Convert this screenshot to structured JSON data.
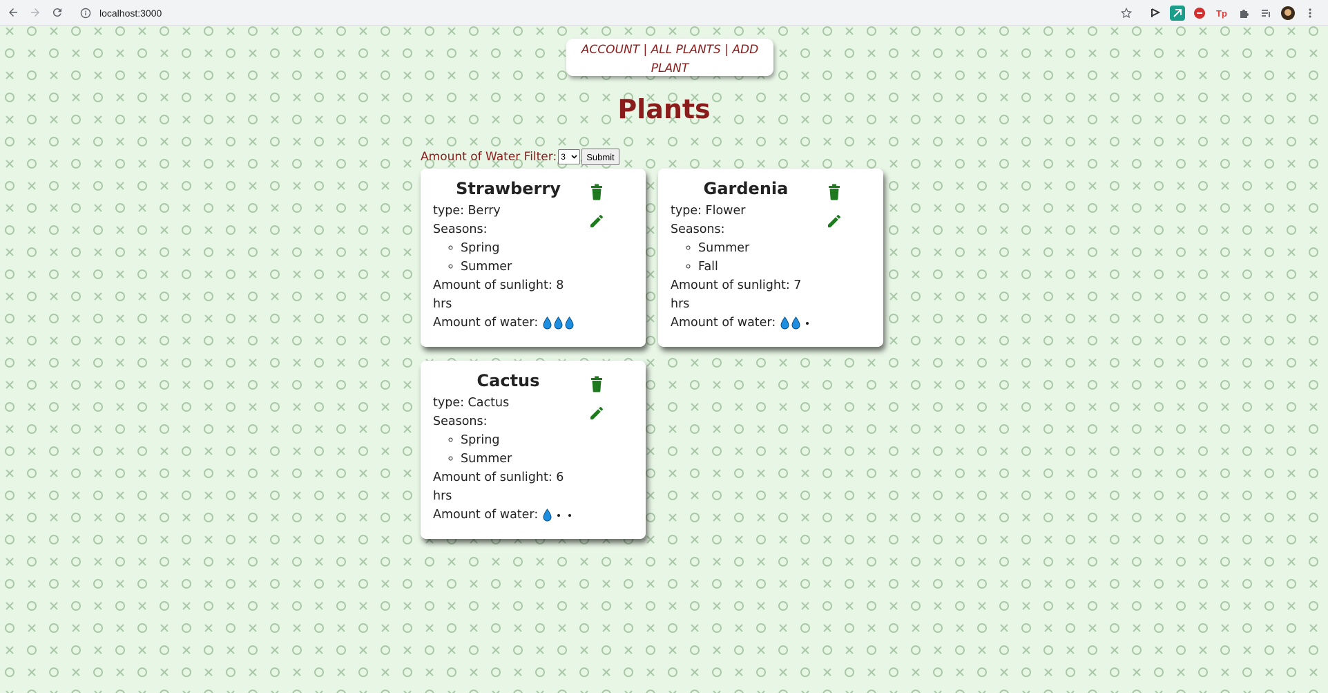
{
  "browser": {
    "url": "localhost:3000"
  },
  "nav": {
    "account": "ACCOUNT",
    "all_plants": "ALL PLANTS",
    "add_plant": "ADD PLANT",
    "separator": " | "
  },
  "page": {
    "title": "Plants"
  },
  "filter": {
    "label": "Amount of Water Filter:",
    "selected": "3",
    "submit_label": "Submit"
  },
  "colors": {
    "accent": "#8b1c1c",
    "icon_green": "#1f7a1f",
    "drop_blue": "#1e8fe0",
    "background": "#e8f6e6"
  },
  "plants": [
    {
      "name": "Strawberry",
      "type_label": "type: Berry",
      "seasons_label": "Seasons:",
      "seasons": [
        "Spring",
        "Summer"
      ],
      "sunlight_label": "Amount of sunlight: 8 hrs",
      "water_label": "Amount of water:",
      "water_level": 3,
      "water_max": 3
    },
    {
      "name": "Gardenia",
      "type_label": "type: Flower",
      "seasons_label": "Seasons:",
      "seasons": [
        "Summer",
        "Fall"
      ],
      "sunlight_label": "Amount of sunlight: 7 hrs",
      "water_label": "Amount of water:",
      "water_level": 2,
      "water_max": 3
    },
    {
      "name": "Cactus",
      "type_label": "type: Cactus",
      "seasons_label": "Seasons:",
      "seasons": [
        "Spring",
        "Summer"
      ],
      "sunlight_label": "Amount of sunlight: 6 hrs",
      "water_label": "Amount of water:",
      "water_level": 1,
      "water_max": 3
    }
  ]
}
